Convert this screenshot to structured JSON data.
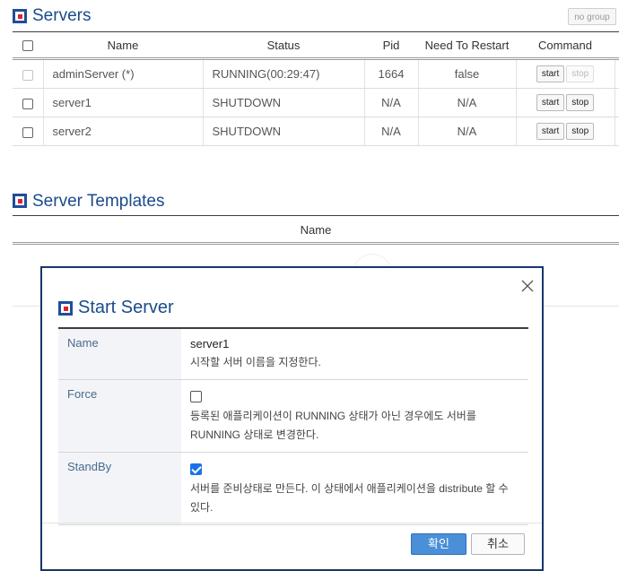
{
  "servers": {
    "title": "Servers",
    "no_group_label": "no group",
    "columns": [
      "Name",
      "Status",
      "Pid",
      "Need To Restart",
      "Command"
    ],
    "rows": [
      {
        "name": "adminServer (*)",
        "status": "RUNNING(00:29:47)",
        "pid": "1664",
        "need_restart": "false",
        "start": "start",
        "stop": "stop"
      },
      {
        "name": "server1",
        "status": "SHUTDOWN",
        "pid": "N/A",
        "need_restart": "N/A",
        "start": "start",
        "stop": "stop"
      },
      {
        "name": "server2",
        "status": "SHUTDOWN",
        "pid": "N/A",
        "need_restart": "N/A",
        "start": "start",
        "stop": "stop"
      }
    ]
  },
  "templates": {
    "title": "Server Templates",
    "column_name": "Name"
  },
  "dialog": {
    "title": "Start Server",
    "fields": [
      {
        "label": "Name",
        "value": "server1",
        "description": "시작할 서버 이름을 지정한다."
      },
      {
        "label": "Force",
        "checked": false,
        "description": "등록된 애플리케이션이 RUNNING 상태가 아닌 경우에도 서버를 RUNNING 상태로 변경한다."
      },
      {
        "label": "StandBy",
        "checked": true,
        "description": "서버를 준비상태로 만든다. 이 상태에서 애플리케이션을 distribute 할 수 있다."
      }
    ],
    "ok_label": "확인",
    "cancel_label": "취소"
  },
  "colors": {
    "title_blue": "#1a4b8c",
    "dialog_border": "#17366b",
    "ok_button": "#4a8fd8",
    "checkbox_checked": "#1a73e8"
  },
  "icons": [
    "section-logo-icon",
    "close-icon",
    "checkbox-icon"
  ]
}
